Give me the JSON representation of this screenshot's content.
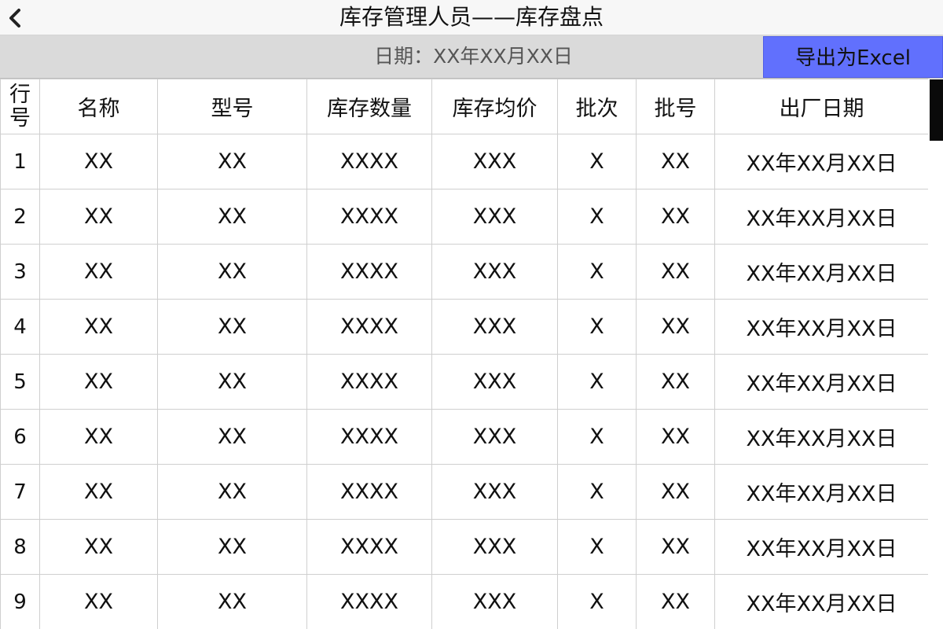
{
  "header": {
    "back_icon": "chevron-left-icon",
    "title": "库存管理人员——库存盘点"
  },
  "toolbar": {
    "date_label": "日期：XX年XX月XX日",
    "export_label": "导出为Excel",
    "export_color": "#6170fd"
  },
  "table": {
    "columns": [
      "行号",
      "名称",
      "型号",
      "库存数量",
      "库存均价",
      "批次",
      "批号",
      "出厂日期"
    ],
    "rows": [
      [
        "1",
        "XX",
        "XX",
        "XXXX",
        "XXX",
        "X",
        "XX",
        "XX年XX月XX日"
      ],
      [
        "2",
        "XX",
        "XX",
        "XXXX",
        "XXX",
        "X",
        "XX",
        "XX年XX月XX日"
      ],
      [
        "3",
        "XX",
        "XX",
        "XXXX",
        "XXX",
        "X",
        "XX",
        "XX年XX月XX日"
      ],
      [
        "4",
        "XX",
        "XX",
        "XXXX",
        "XXX",
        "X",
        "XX",
        "XX年XX月XX日"
      ],
      [
        "5",
        "XX",
        "XX",
        "XXXX",
        "XXX",
        "X",
        "XX",
        "XX年XX月XX日"
      ],
      [
        "6",
        "XX",
        "XX",
        "XXXX",
        "XXX",
        "X",
        "XX",
        "XX年XX月XX日"
      ],
      [
        "7",
        "XX",
        "XX",
        "XXXX",
        "XXX",
        "X",
        "XX",
        "XX年XX月XX日"
      ],
      [
        "8",
        "XX",
        "XX",
        "XXXX",
        "XXX",
        "X",
        "XX",
        "XX年XX月XX日"
      ],
      [
        "9",
        "XX",
        "XX",
        "XXXX",
        "XXX",
        "X",
        "XX",
        "XX年XX月XX日"
      ]
    ]
  },
  "scrollbar": {
    "thumb_color": "#0a0a0a"
  }
}
